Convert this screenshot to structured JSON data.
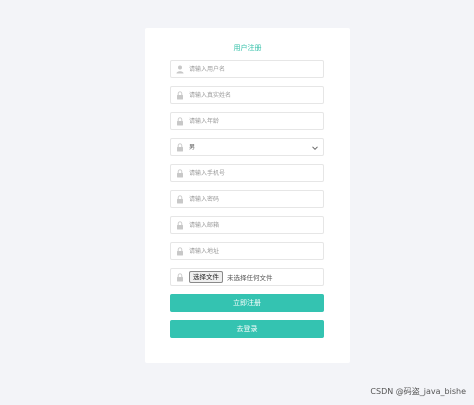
{
  "form": {
    "title": "用户注册",
    "fields": [
      {
        "placeholder": "请输入用户名",
        "icon": "user-icon"
      },
      {
        "placeholder": "请输入真实姓名",
        "icon": "lock-icon"
      },
      {
        "placeholder": "请输入年龄",
        "icon": "lock-icon"
      },
      {
        "selected": "男",
        "icon": "lock-icon"
      },
      {
        "placeholder": "请输入手机号",
        "icon": "lock-icon"
      },
      {
        "placeholder": "请输入密码",
        "icon": "lock-icon"
      },
      {
        "placeholder": "请输入邮箱",
        "icon": "lock-icon"
      },
      {
        "placeholder": "请输入地址",
        "icon": "lock-icon"
      }
    ],
    "file": {
      "button_label": "选择文件",
      "status": "未选择任何文件",
      "icon": "lock-icon"
    },
    "submit_label": "立即注册",
    "login_label": "去登录"
  },
  "watermark": "CSDN @码盗_java_bishe",
  "colors": {
    "accent": "#34c3b1",
    "title": "#2fbfa7",
    "background": "#f3f4f8"
  }
}
